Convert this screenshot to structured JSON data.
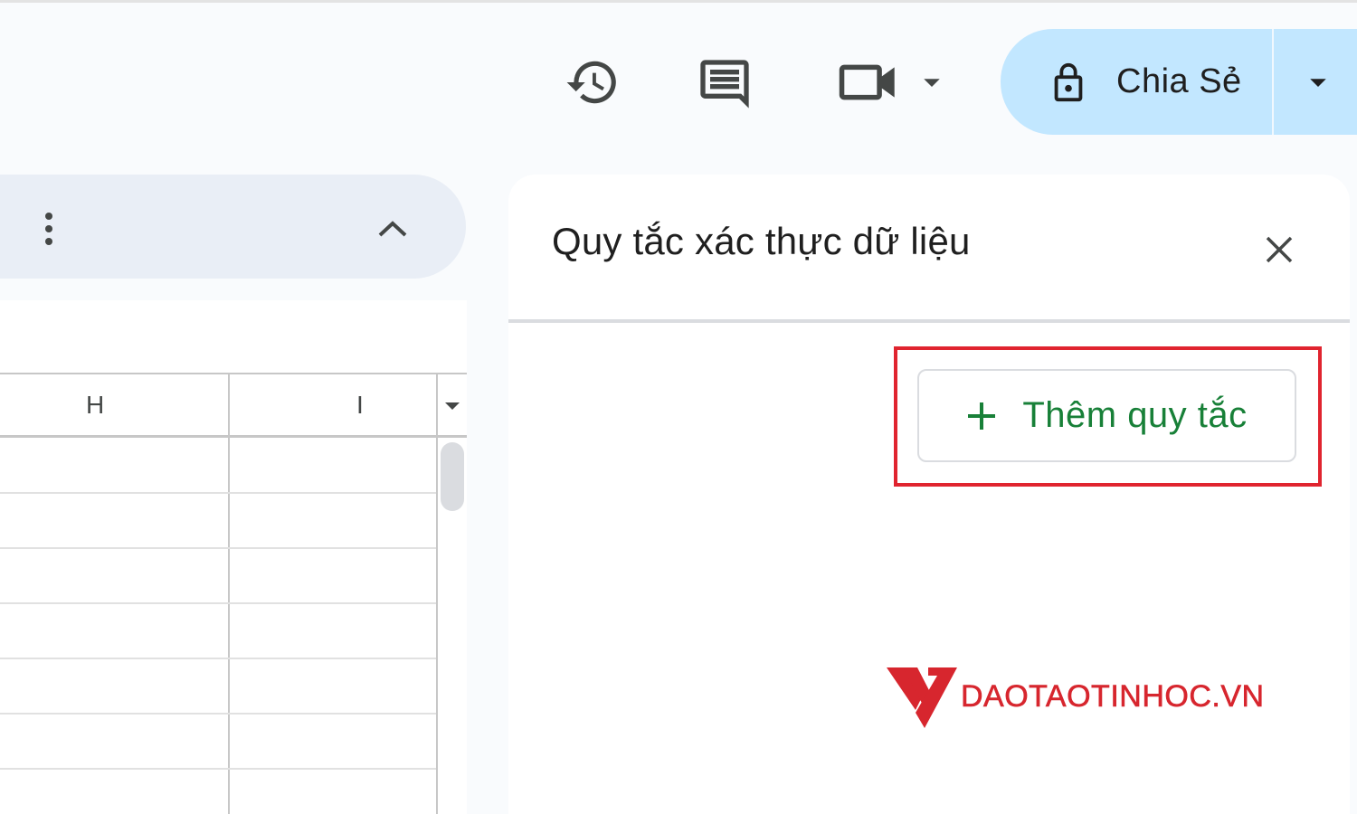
{
  "header": {
    "share_label": "Chia Sẻ",
    "icons": [
      "history-icon",
      "comment-icon",
      "video-icon",
      "chevron-down-icon",
      "lock-icon"
    ]
  },
  "grid": {
    "columns": [
      "H",
      "I"
    ]
  },
  "side_panel": {
    "title": "Quy tắc xác thực dữ liệu",
    "add_rule_label": "Thêm quy tắc"
  },
  "watermark": {
    "text": "DAOTAOTINHOC.VN"
  },
  "colors": {
    "share_bg": "#c2e7ff",
    "add_rule_text": "#188038",
    "highlight": "#e0242f",
    "brand_red": "#d7262e"
  }
}
